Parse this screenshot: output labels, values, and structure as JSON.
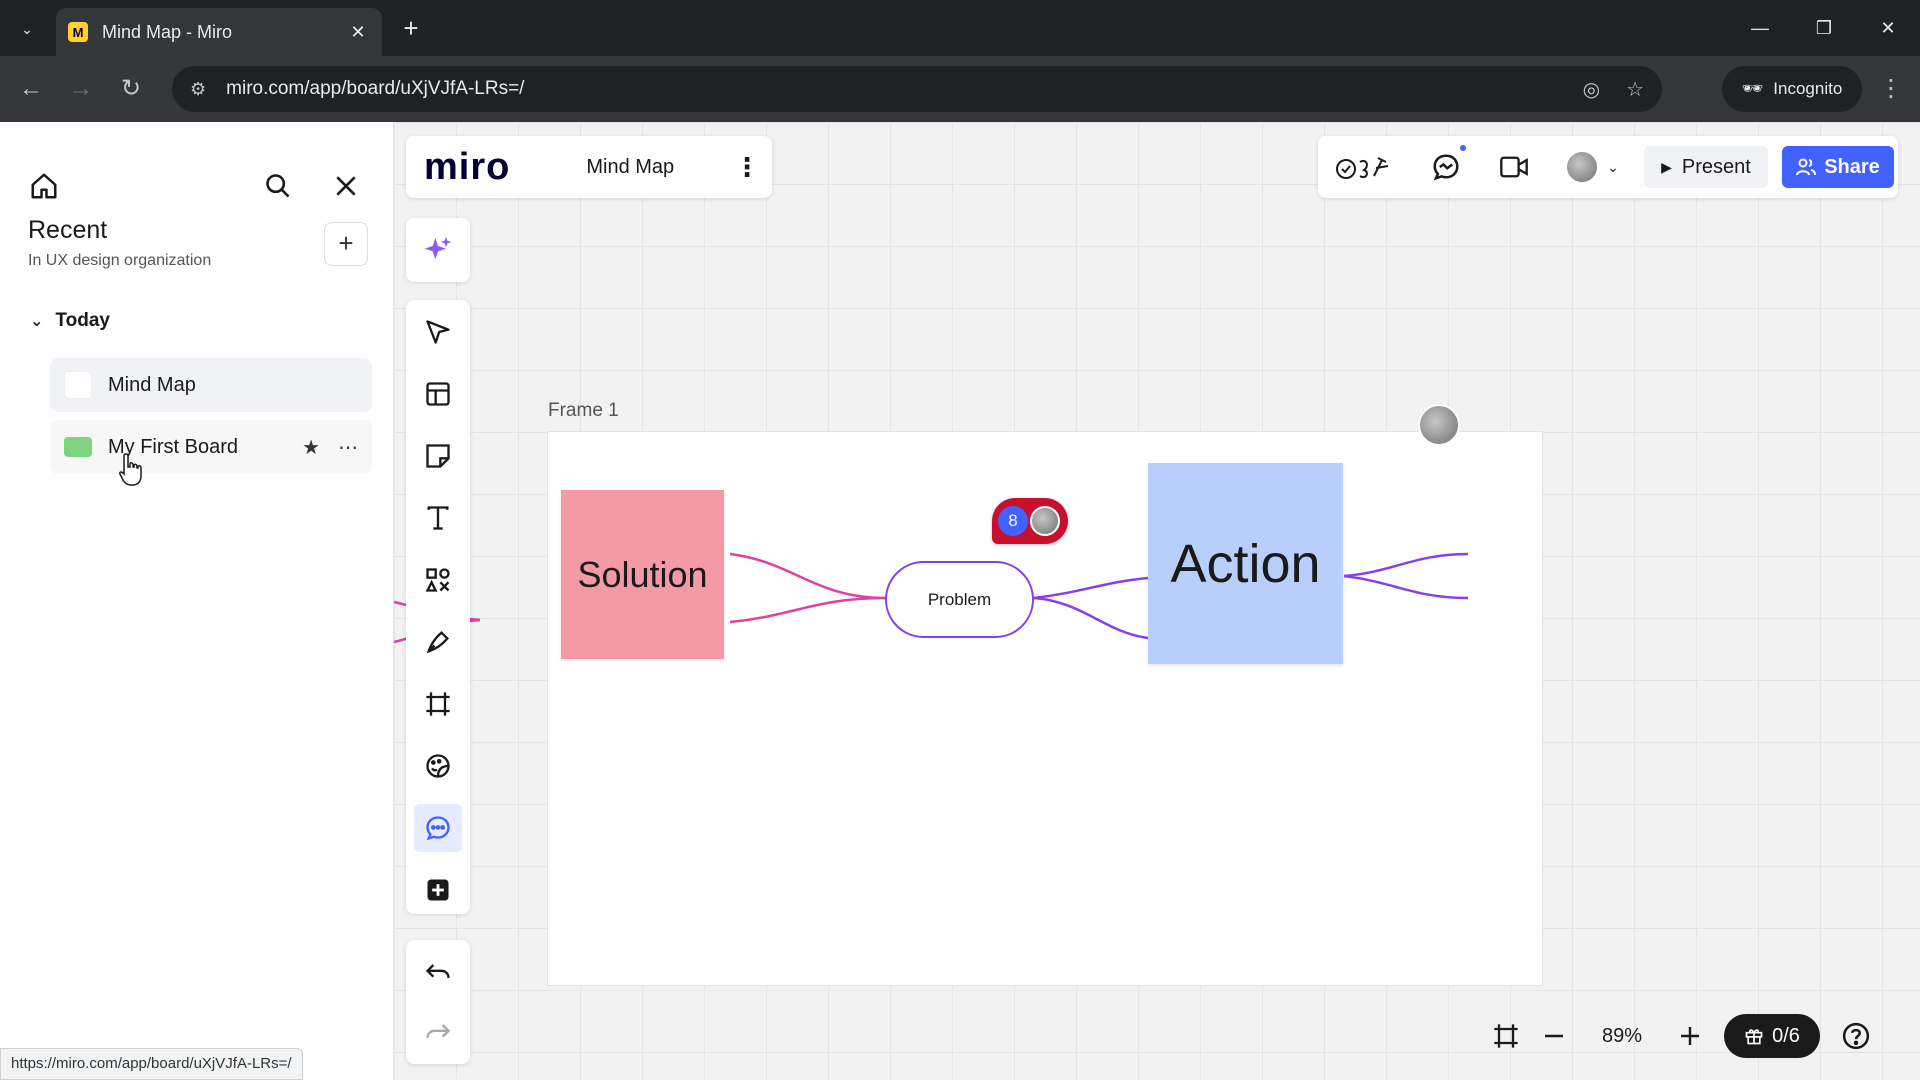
{
  "browser": {
    "tab_title": "Mind Map - Miro",
    "url": "miro.com/app/board/uXjVJfA-LRs=/",
    "incognito_label": "Incognito",
    "status_url": "https://miro.com/app/board/uXjVJfA-LRs=/"
  },
  "sidebar": {
    "title": "Recent",
    "subtitle": "In UX design organization",
    "group_label": "Today",
    "items": [
      {
        "label": "Mind Map",
        "active": true
      },
      {
        "label": "My First Board",
        "active": false
      }
    ]
  },
  "board": {
    "logo": "miro",
    "name": "Mind Map",
    "present_label": "Present",
    "share_label": "Share"
  },
  "canvas": {
    "frame_label": "Frame 1",
    "nodes": {
      "solution": "Solution",
      "problem": "Problem",
      "action": "Action"
    },
    "comment_count": "8"
  },
  "bottom": {
    "zoom": "89%",
    "gift_count": "0/6"
  },
  "colors": {
    "accent": "#4262ff",
    "solution_sticky": "#f49aa6",
    "action_sticky": "#b8cffc",
    "connector_pink": "#e040a0",
    "connector_purple": "#8a3ee8",
    "comment_red": "#c8102e"
  },
  "icons": {
    "tools": [
      "select-icon",
      "templates-icon",
      "sticky-note-icon",
      "text-icon",
      "shapes-icon",
      "pen-icon",
      "frame-icon",
      "stickers-icon",
      "comment-icon",
      "more-apps-icon"
    ]
  }
}
